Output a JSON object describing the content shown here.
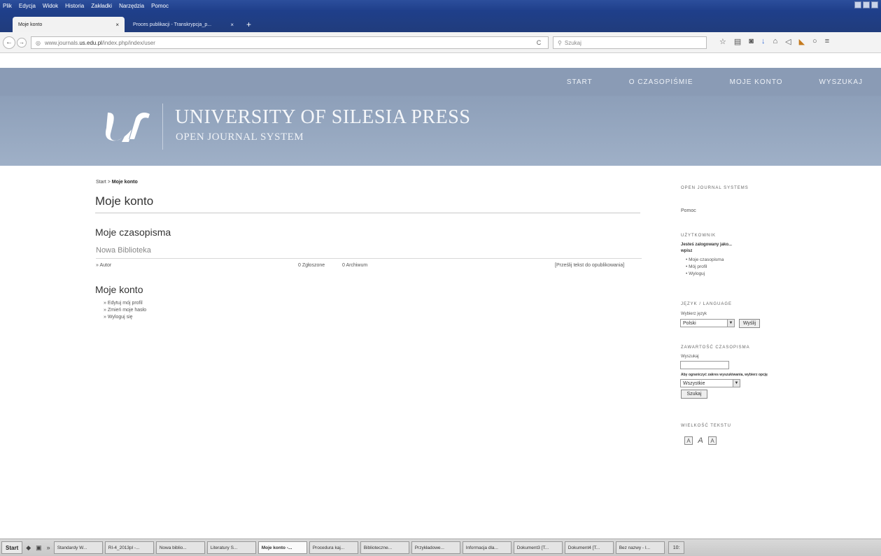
{
  "browser": {
    "menu": [
      "Plik",
      "Edycja",
      "Widok",
      "Historia",
      "Zakładki",
      "Narzędzia",
      "Pomoc"
    ],
    "tabs": [
      {
        "label": "Moje konto",
        "active": true
      },
      {
        "label": "Proces publikacji - Transkrypcja_p...",
        "active": false
      }
    ],
    "url_prefix": "www.journals.",
    "url_host": "us.edu.pl",
    "url_rest": "/index.php/index/user",
    "search_placeholder": "Szukaj"
  },
  "site_nav": [
    "START",
    "O CZASOPIŚMIE",
    "MOJE KONTO",
    "WYSZUKAJ"
  ],
  "brand": {
    "title": "UNIVERSITY OF SILESIA PRESS",
    "subtitle": "OPEN JOURNAL SYSTEM"
  },
  "main": {
    "breadcrumb_start": "Start",
    "breadcrumb_sep": " > ",
    "breadcrumb_current": "Moje konto",
    "page_title": "Moje konto",
    "journals_heading": "Moje czasopisma",
    "journal_name": "Nowa Biblioteka",
    "role": "» Autor",
    "submitted": "0 Zgłoszone",
    "archived": "0 Archiwum",
    "new_submission": "[Prześlij tekst do opublikowania]",
    "account_heading": "Moje konto",
    "account_links": [
      "» Edytuj mój profil",
      "» Zmień moje hasło",
      "» Wyloguj się"
    ]
  },
  "sidebar": {
    "ojs_label": "OPEN JOURNAL SYSTEMS",
    "help_label": "Pomoc",
    "users_heading": "UŻYTKOWNIK",
    "logged_in_line1": "Jesteś zalogowany jako...",
    "logged_in_line2": "wpisz",
    "user_links": [
      "Moje czasopisma",
      "Mój profil",
      "Wyloguj"
    ],
    "lang_heading": "JĘZYK / LANGUAGE",
    "lang_label": "Wybierz język",
    "lang_value": "Polski",
    "lang_button": "Wyślij",
    "search_heading": "ZAWARTOŚĆ CZASOPISMA",
    "search_label": "Wyszukaj",
    "scope_label": "Aby ograniczyć zakres wyszukiwania, wybierz opcję",
    "scope_value": "Wszystkie",
    "search_button": "Szukaj",
    "fontsize_heading": "WIELKOŚĆ TEKSTU"
  },
  "taskbar": {
    "start": "Start",
    "tasks": [
      "Standardy W...",
      "RI-4_2013pl -...",
      "Nowa biblio...",
      "Literatury S...",
      "Moje konto -...",
      "Procedura kaj...",
      "Biblioteczne...",
      "Przykładowe...",
      "Informacja dla...",
      "Dokument3 [T...",
      "Dokument4 [T...",
      "Bez nazwy - I..."
    ],
    "tray": "10:"
  },
  "colors": {
    "nav_bg": "#8a9bb5",
    "banner_bg": "#9fb0c7",
    "titlebar": "#1f3f8a"
  }
}
